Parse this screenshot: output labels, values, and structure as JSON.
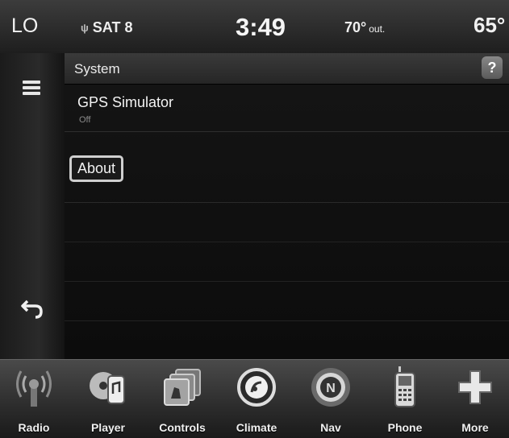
{
  "status_bar": {
    "lo": "LO",
    "sat": "SAT 8",
    "time": "3:49",
    "temp_out": "70°",
    "temp_out_unit": "out.",
    "temp_right": "65°"
  },
  "header": {
    "title": "System",
    "help": "?"
  },
  "settings": {
    "gps_label": "GPS Simulator",
    "gps_status": "Off",
    "about_label": "About"
  },
  "dock": {
    "items": [
      {
        "label": "Radio",
        "icon": "radio-icon"
      },
      {
        "label": "Player",
        "icon": "player-icon"
      },
      {
        "label": "Controls",
        "icon": "controls-icon"
      },
      {
        "label": "Climate",
        "icon": "climate-icon"
      },
      {
        "label": "Nav",
        "icon": "nav-icon"
      },
      {
        "label": "Phone",
        "icon": "phone-icon"
      },
      {
        "label": "More",
        "icon": "more-icon"
      }
    ]
  },
  "colors": {
    "background": "#0a0a0a",
    "text": "#e8e8e8",
    "nav_accent": "#d6d6d6"
  }
}
